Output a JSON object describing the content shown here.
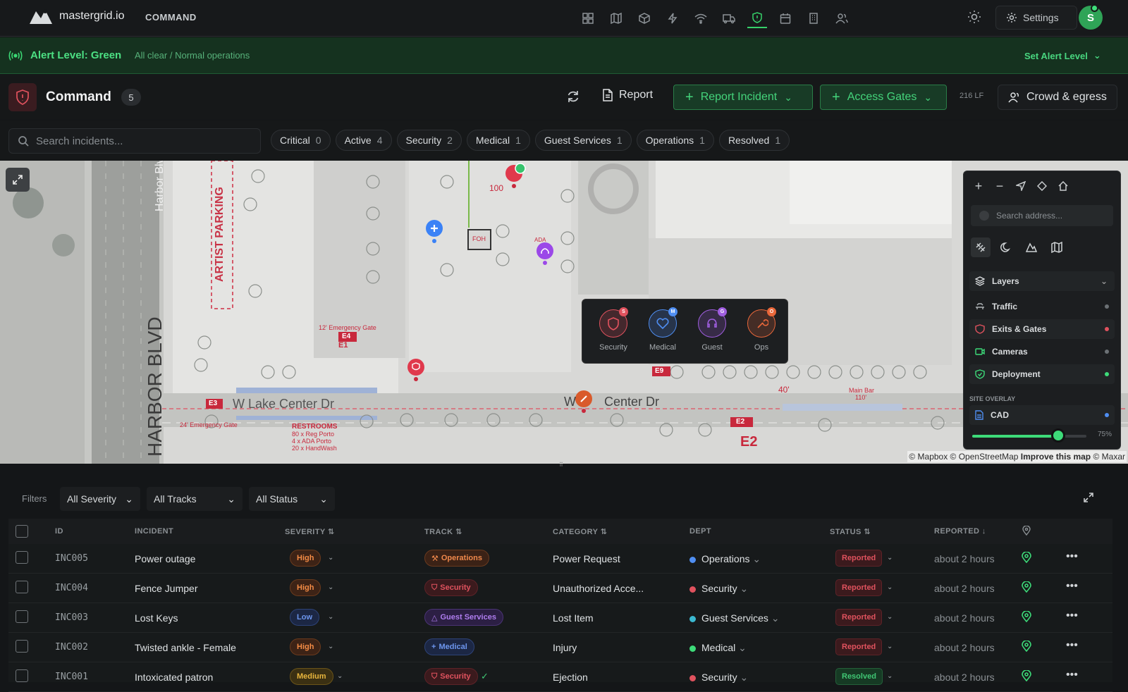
{
  "app": {
    "brand": "mastergrid.io",
    "section": "COMMAND",
    "settings_label": "Settings",
    "avatar_initial": "S",
    "accent": "#36d16a"
  },
  "nav_icons": [
    "dashboard-icon",
    "map-icon",
    "cube-icon",
    "lightning-icon",
    "wifi-icon",
    "truck-icon",
    "shield-icon",
    "calendar-icon",
    "building-icon",
    "users-icon"
  ],
  "alert": {
    "title": "Alert Level: Green",
    "subtitle": "All clear / Normal operations",
    "action": "Set Alert Level"
  },
  "header": {
    "title": "Command",
    "count": "5",
    "report_label": "Report",
    "report_incident_label": "Report Incident",
    "access_gates_label": "Access Gates",
    "lf_label": "216 LF",
    "crowd_label": "Crowd & egress"
  },
  "search": {
    "placeholder": "Search incidents..."
  },
  "chips": [
    {
      "label": "Critical",
      "count": "0"
    },
    {
      "label": "Active",
      "count": "4"
    },
    {
      "label": "Security",
      "count": "2"
    },
    {
      "label": "Medical",
      "count": "1"
    },
    {
      "label": "Guest Services",
      "count": "1"
    },
    {
      "label": "Operations",
      "count": "1"
    },
    {
      "label": "Resolved",
      "count": "1"
    }
  ],
  "map": {
    "labels": {
      "harbor_blvd_small": "Harbor Blvd",
      "harbor_blvd_big": "HARBOR BLVD",
      "artist_parking": "ARTIST PARKING",
      "lake_center": "W Lake Center Dr",
      "center_dr": "W        Center Dr",
      "emergency_gate_12": "12' Emergency Gate",
      "emergency_gate_24": "24' Emergency Gate",
      "restrooms": "RESTROOMS",
      "restrooms_1": "80 x Reg Porto",
      "restrooms_2": "4 x ADA Porto",
      "restrooms_3": "20 x HandWash",
      "main_bar": "Main Bar",
      "main_bar_len": "110'",
      "dist_40": "40'",
      "dist_100": "100",
      "foh": "FOH",
      "ada": "ADA",
      "e1": "E1",
      "e2": "E2",
      "e3": "E3",
      "e4": "E4",
      "e9": "E9"
    },
    "quick_report": [
      {
        "label": "Security",
        "badge": "S",
        "color": "#e0525e"
      },
      {
        "label": "Medical",
        "badge": "M",
        "color": "#4f8ef2"
      },
      {
        "label": "Guest",
        "badge": "G",
        "color": "#a05ee0"
      },
      {
        "label": "Ops",
        "badge": "O",
        "color": "#e8673a"
      }
    ],
    "attribution": {
      "a": "© Mapbox © OpenStreetMap",
      "b": "Improve this map",
      "c": "© Maxar"
    }
  },
  "panel": {
    "search_placeholder": "Search address...",
    "layers_label": "Layers",
    "layers": [
      {
        "label": "Traffic",
        "status_color": "#6c7175"
      },
      {
        "label": "Exits & Gates",
        "status_color": "#e0525e"
      },
      {
        "label": "Cameras",
        "status_color": "#6c7175"
      },
      {
        "label": "Deployment",
        "status_color": "#3ddb79"
      }
    ],
    "site_overlay_label": "SITE OVERLAY",
    "cad_label": "CAD",
    "cad_status_color": "#4f8ef2",
    "opacity": "75%",
    "opacity_value": 0.75
  },
  "filters": {
    "label": "Filters",
    "severity": "All Severity",
    "tracks": "All Tracks",
    "status": "All Status"
  },
  "table": {
    "headers": {
      "id": "ID",
      "incident": "INCIDENT",
      "severity": "SEVERITY",
      "track": "TRACK",
      "category": "CATEGORY",
      "dept": "DEPT",
      "status": "STATUS",
      "reported": "REPORTED"
    },
    "rows": [
      {
        "id": "INC005",
        "incident": "Power outage",
        "severity": "High",
        "track": "Operations",
        "category": "Power Request",
        "dept": "Operations",
        "dept_color": "#4f8ef2",
        "status": "Reported",
        "reported": "about 2 hours"
      },
      {
        "id": "INC004",
        "incident": "Fence Jumper",
        "severity": "High",
        "track": "Security",
        "category": "Unauthorized Acce...",
        "dept": "Security",
        "dept_color": "#e0525e",
        "status": "Reported",
        "reported": "about 2 hours"
      },
      {
        "id": "INC003",
        "incident": "Lost Keys",
        "severity": "Low",
        "track": "Guest Services",
        "category": "Lost Item",
        "dept": "Guest Services",
        "dept_color": "#3bb8d0",
        "status": "Reported",
        "reported": "about 2 hours"
      },
      {
        "id": "INC002",
        "incident": "Twisted ankle - Female",
        "severity": "High",
        "track": "Medical",
        "category": "Injury",
        "dept": "Medical",
        "dept_color": "#3ddb79",
        "status": "Reported",
        "reported": "about 2 hours"
      },
      {
        "id": "INC001",
        "incident": "Intoxicated patron",
        "severity": "Medium",
        "track": "Security",
        "category": "Ejection",
        "dept": "Security",
        "dept_color": "#e0525e",
        "status": "Resolved",
        "reported": "about 2 hours"
      }
    ]
  }
}
